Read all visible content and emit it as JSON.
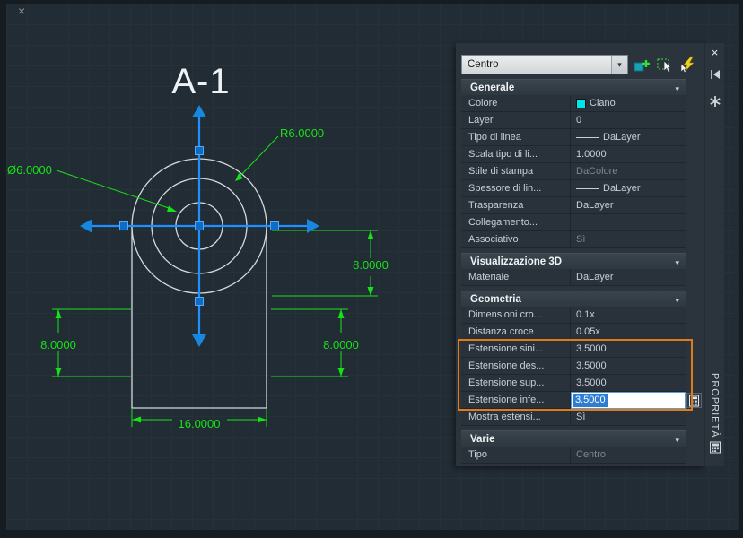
{
  "colors": {
    "accent_orange": "#e07b1a",
    "dimension_green": "#17e217",
    "grip_blue": "#1e90ff",
    "swatch_cyan": "#00e5e5"
  },
  "drawing": {
    "title": "A-1",
    "canvas_close_glyph": "×",
    "dims": {
      "radius": "R6.0000",
      "diameter": "Ø6.0000",
      "right_upper": "8.0000",
      "right_lower": "8.0000",
      "left": "8.0000",
      "bottom": "16.0000"
    }
  },
  "palette": {
    "selector_value": "Centro",
    "combo_arrow_glyph": "▾",
    "section_chevron_glyph": "▾",
    "close_glyph": "×",
    "vertical_title": "PROPRIETÀ",
    "sections": [
      {
        "title": "Generale",
        "rows": [
          {
            "label": "Colore",
            "value": "Ciano"
          },
          {
            "label": "Layer",
            "value": "0"
          },
          {
            "label": "Tipo di linea",
            "value": "DaLayer"
          },
          {
            "label": "Scala tipo di li...",
            "value": "1.0000"
          },
          {
            "label": "Stile di stampa",
            "value": "DaColore"
          },
          {
            "label": "Spessore di lin...",
            "value": "DaLayer"
          },
          {
            "label": "Trasparenza",
            "value": "DaLayer"
          },
          {
            "label": "Collegamento...",
            "value": ""
          },
          {
            "label": "Associativo",
            "value": "Sì"
          }
        ]
      },
      {
        "title": "Visualizzazione 3D",
        "rows": [
          {
            "label": "Materiale",
            "value": "DaLayer"
          }
        ]
      },
      {
        "title": "Geometria",
        "rows": [
          {
            "label": "Dimensioni cro...",
            "value": "0.1x"
          },
          {
            "label": "Distanza croce",
            "value": "0.05x"
          },
          {
            "label": "Estensione sini...",
            "value": "3.5000"
          },
          {
            "label": "Estensione des...",
            "value": "3.5000"
          },
          {
            "label": "Estensione sup...",
            "value": "3.5000"
          },
          {
            "label": "Estensione infe...",
            "value": "3.5000"
          },
          {
            "label": "Mostra estensi...",
            "value": "Sì"
          }
        ]
      },
      {
        "title": "Varie",
        "rows": [
          {
            "label": "Tipo",
            "value": "Centro"
          }
        ]
      }
    ]
  }
}
